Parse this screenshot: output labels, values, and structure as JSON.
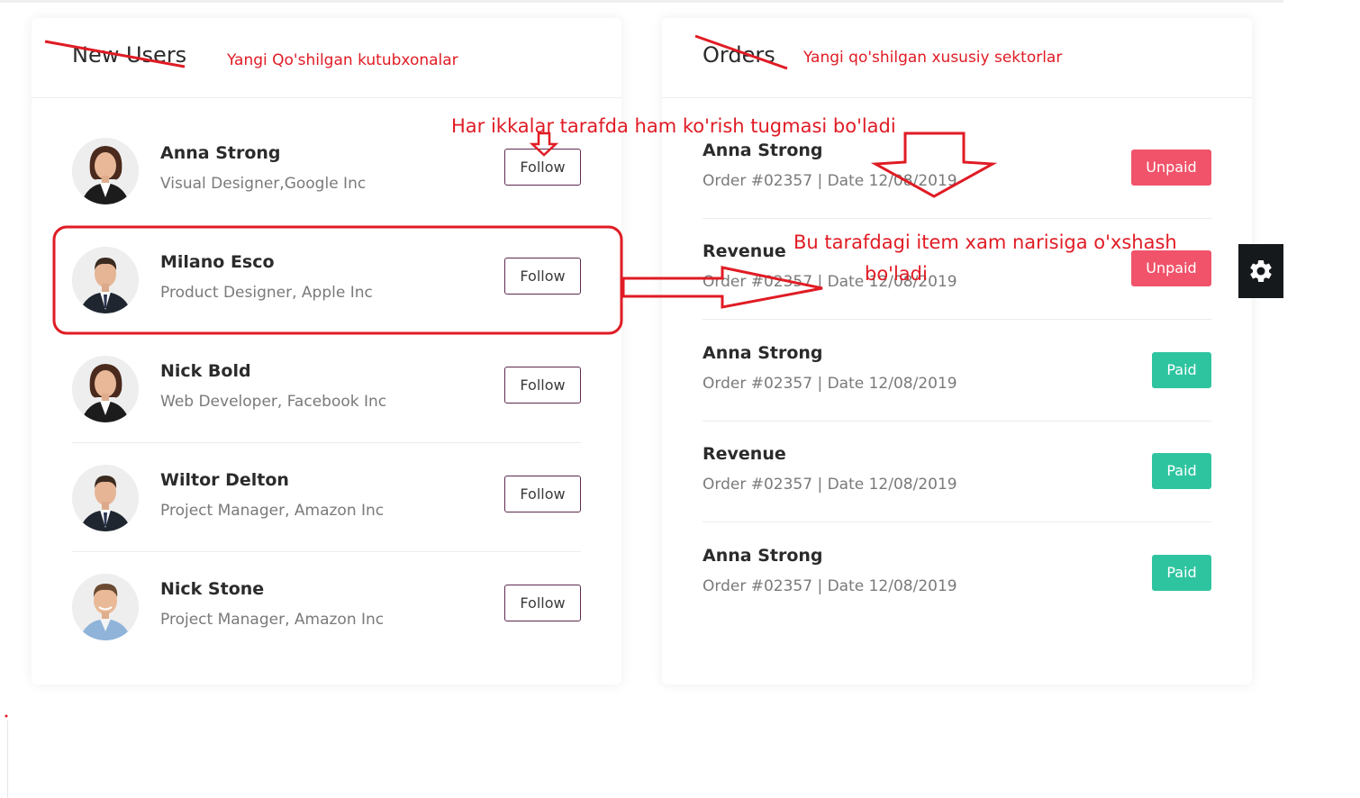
{
  "users_card": {
    "title": "New Users",
    "annotation": "Yangi Qo'shilgan kutubxonalar",
    "follow_label": "Follow",
    "users": [
      {
        "name": "Anna Strong",
        "role": "Visual Designer,Google Inc",
        "avatar": "female-avatar"
      },
      {
        "name": "Milano Esco",
        "role": "Product Designer, Apple Inc",
        "avatar": "male-avatar"
      },
      {
        "name": "Nick Bold",
        "role": "Web Developer, Facebook Inc",
        "avatar": "female-avatar"
      },
      {
        "name": "Wiltor Delton",
        "role": "Project Manager, Amazon Inc",
        "avatar": "male-avatar"
      },
      {
        "name": "Nick Stone",
        "role": "Project Manager, Amazon Inc",
        "avatar": "male-avatar"
      }
    ]
  },
  "orders_card": {
    "title": "Orders",
    "annotation": "Yangi qo'shilgan xususiy sektorlar",
    "orders": [
      {
        "title": "Anna Strong",
        "meta": "Order #02357 | Date 12/08/2019",
        "status": "Unpaid"
      },
      {
        "title": "Revenue",
        "meta": "Order #02357 | Date 12/08/2019",
        "status": "Unpaid"
      },
      {
        "title": "Anna Strong",
        "meta": "Order #02357 | Date 12/08/2019",
        "status": "Paid"
      },
      {
        "title": "Revenue",
        "meta": "Order #02357 | Date 12/08/2019",
        "status": "Paid"
      },
      {
        "title": "Anna Strong",
        "meta": "Order #02357 | Date 12/08/2019",
        "status": "Paid"
      }
    ]
  },
  "annotations": {
    "top_note": "Har ikkalar tarafda ham ko'rish tugmasi bo'ladi",
    "side_note_line1": "Bu tarafdagi item xam narisiga o'xshash",
    "side_note_line2": "bo'ladi",
    "color": "#e01b24"
  },
  "settings": {
    "icon": "gear-icon"
  },
  "colors": {
    "unpaid": "#f0536a",
    "paid": "#2fc4a0",
    "follow_border": "#5c2a4e",
    "settings_bg": "#16191c"
  }
}
